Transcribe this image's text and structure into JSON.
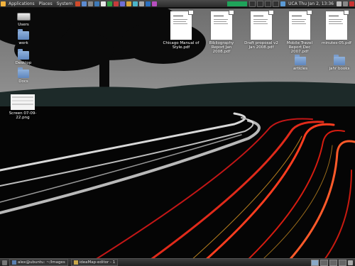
{
  "top_panel": {
    "menus": [
      "Applications",
      "Places",
      "System"
    ],
    "clock": "UCA Thu Jan 2, 13:36"
  },
  "desktop": {
    "left_icons": [
      {
        "label": "Users",
        "icon": "drive-icon"
      },
      {
        "label": "work",
        "icon": "folder-icon"
      },
      {
        "label": "Desktop",
        "icon": "folder-icon"
      },
      {
        "label": "Docs",
        "icon": "folder-icon"
      }
    ],
    "screenshot_icon": {
      "label": "Screen 07-09-22.png"
    },
    "documents": [
      {
        "label": "Chicago Manual of Style.pdf"
      },
      {
        "label": "Bibliography Report Jan 2008.pdf"
      },
      {
        "label": "Draft proposal v2 Jan 2008.pdf"
      },
      {
        "label": "Mobile Travel Report Dec 2007.pdf"
      },
      {
        "label": "minutes-05.pdf"
      }
    ],
    "right_folders": [
      {
        "label": "articles"
      },
      {
        "label": "jahr books"
      }
    ]
  },
  "taskbar": {
    "tasks": [
      {
        "label": "alex@ubuntu: ~/Images"
      },
      {
        "label": "ideaMap-editor - 1"
      }
    ]
  },
  "colors": {
    "panel": "#2b2b2b",
    "tray_accent": "#1fa35a",
    "folder": "#5f86bd"
  }
}
